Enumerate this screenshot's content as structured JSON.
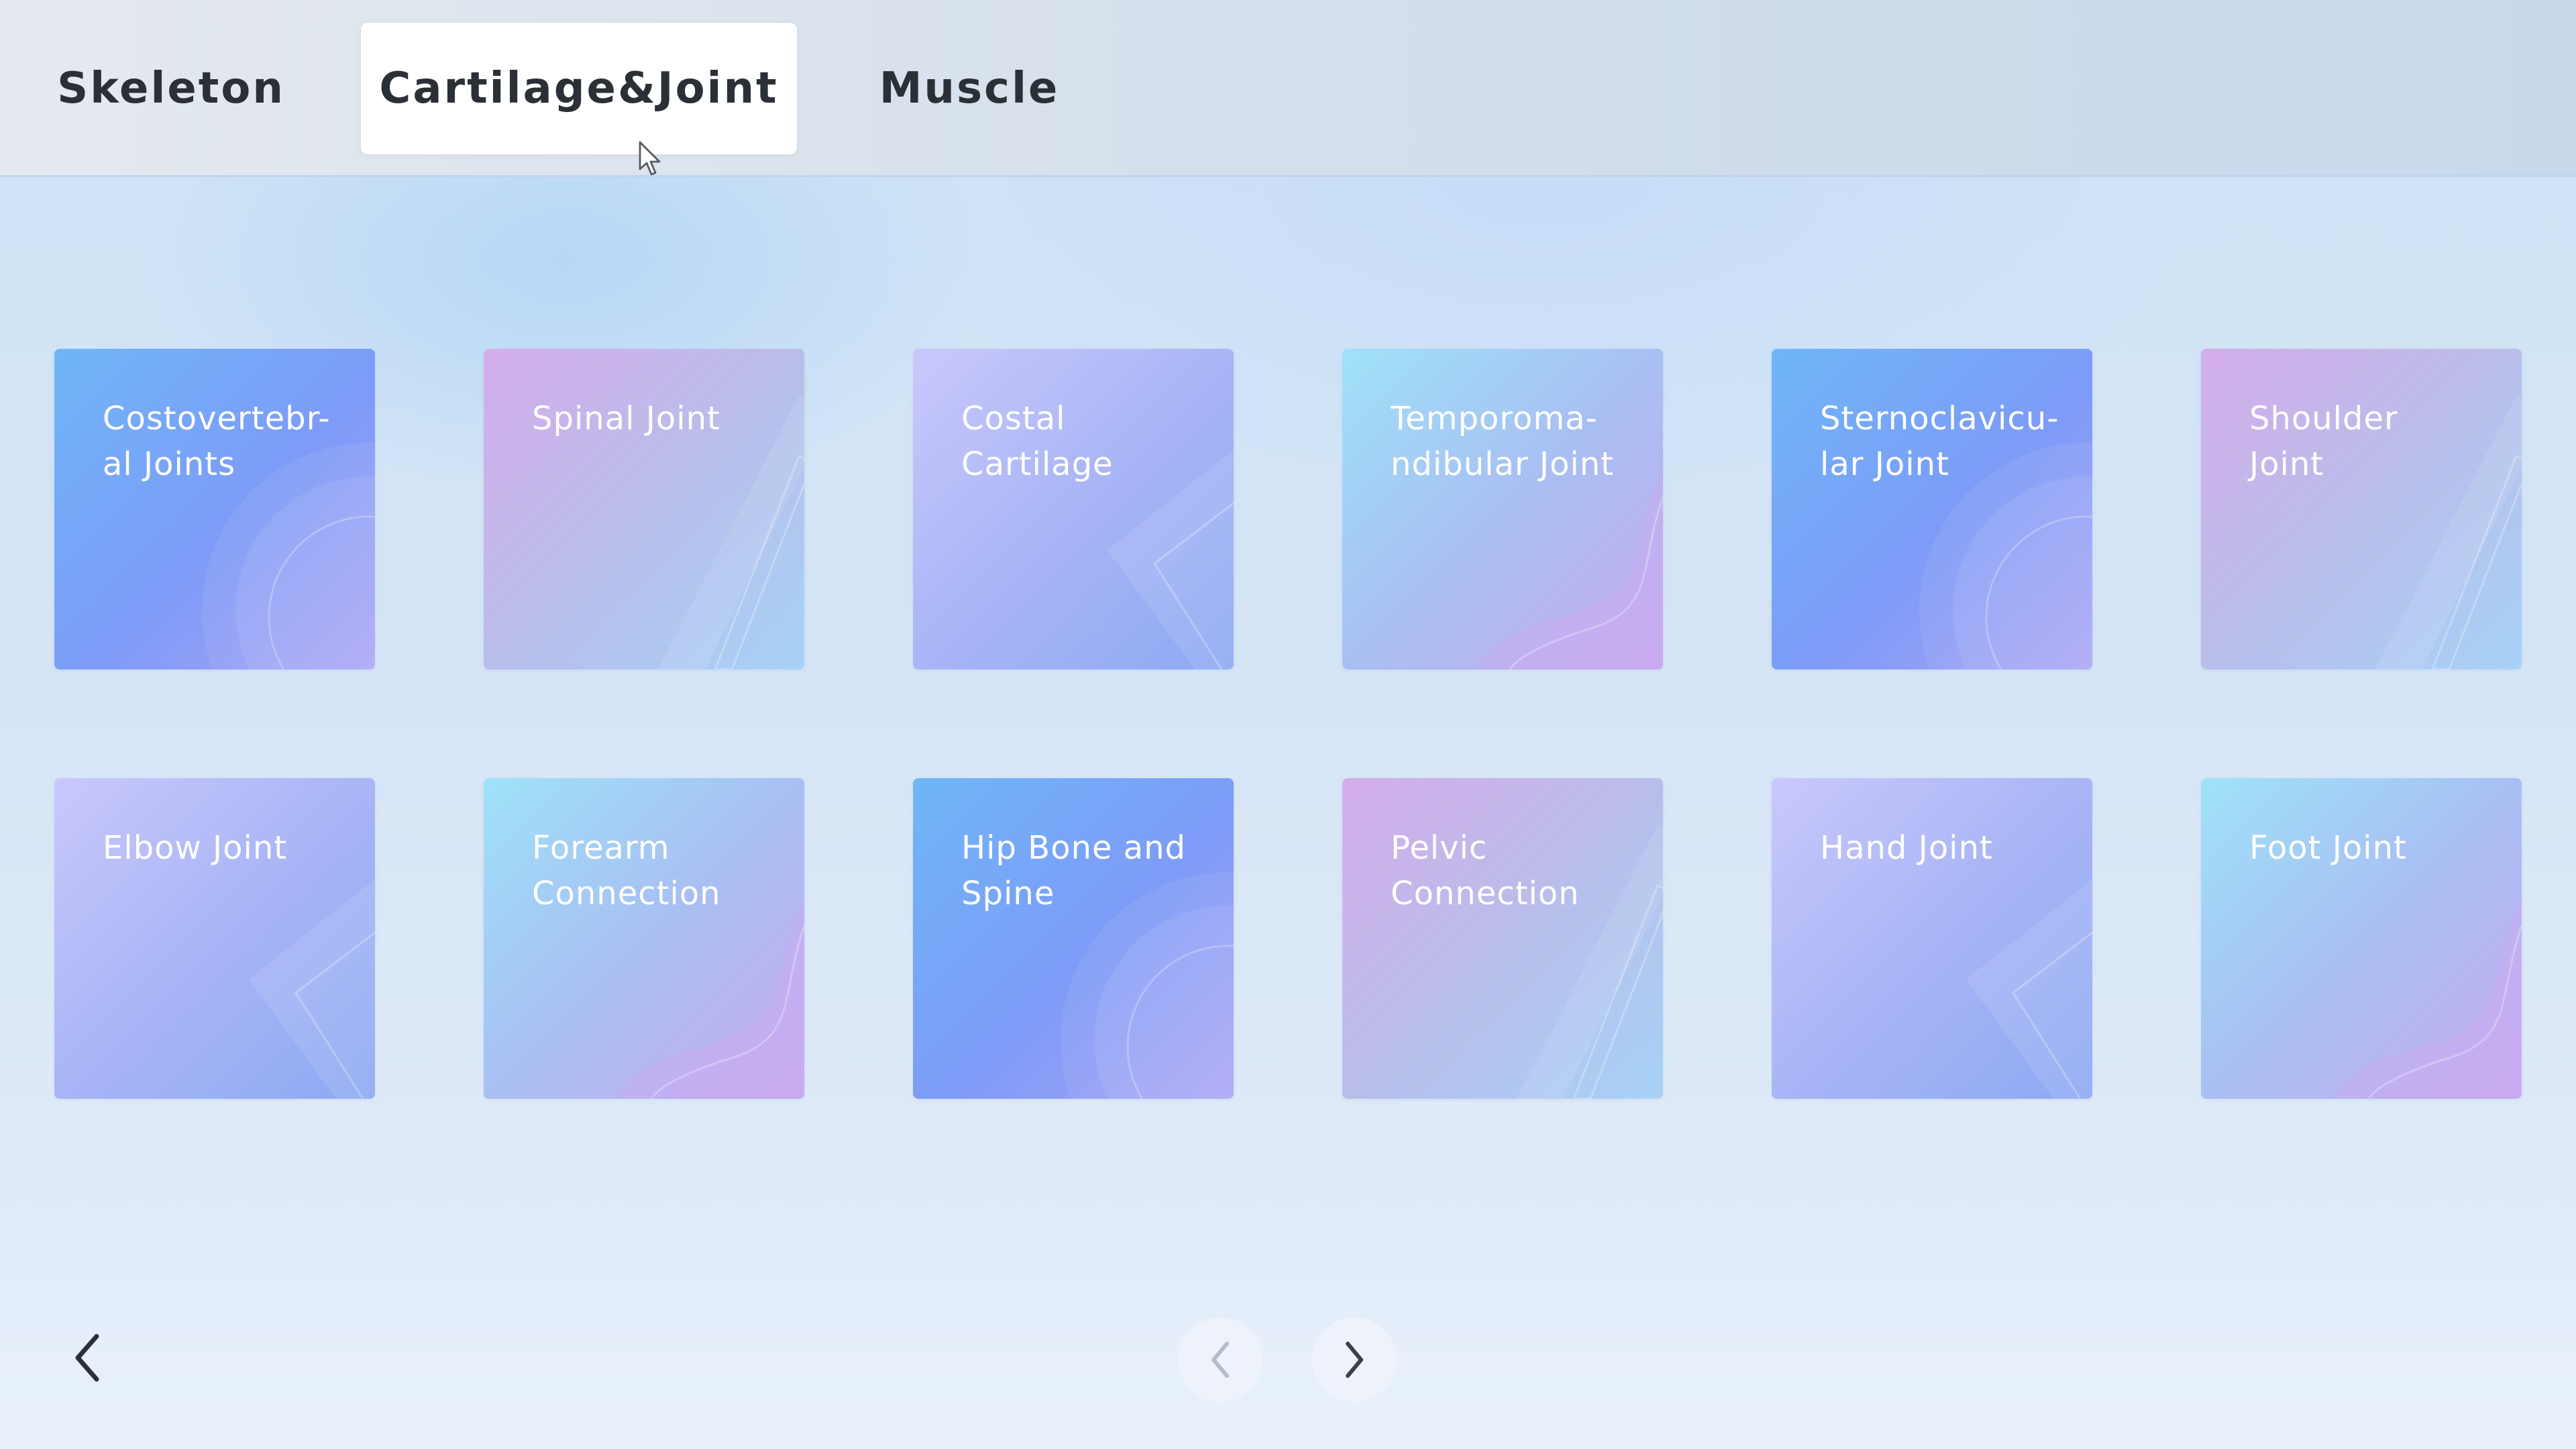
{
  "tabs": [
    {
      "label": "Skeleton",
      "active": false
    },
    {
      "label": "Cartilage&Joint",
      "active": true
    },
    {
      "label": "Muscle",
      "active": false
    }
  ],
  "tiles": [
    {
      "label": "Costovertebr-\nal Joints",
      "style": "blue",
      "decoration": "arc-icon"
    },
    {
      "label": "Spinal Joint",
      "style": "pink",
      "decoration": "slash-icon"
    },
    {
      "label": "Costal\nCartilage",
      "style": "lavender",
      "decoration": "chevron-icon"
    },
    {
      "label": "Temporoma-\nndibular Joint",
      "style": "cyan",
      "decoration": "wave-icon"
    },
    {
      "label": "Sternoclavicu-\nlar Joint",
      "style": "blue",
      "decoration": "arc-icon"
    },
    {
      "label": "Shoulder\nJoint",
      "style": "pink",
      "decoration": "slash-icon"
    },
    {
      "label": "Elbow Joint",
      "style": "lavender",
      "decoration": "chevron-icon"
    },
    {
      "label": "Forearm\nConnection",
      "style": "cyan",
      "decoration": "wave-icon"
    },
    {
      "label": "Hip Bone and\nSpine",
      "style": "blue",
      "decoration": "arc-icon"
    },
    {
      "label": "Pelvic\nConnection",
      "style": "pink",
      "decoration": "slash-icon"
    },
    {
      "label": "Hand Joint",
      "style": "lavender",
      "decoration": "chevron-icon"
    },
    {
      "label": "Foot Joint",
      "style": "cyan",
      "decoration": "wave-icon"
    }
  ],
  "navigation": {
    "back_icon": "chevron-left-icon",
    "prev_icon": "chevron-left-icon",
    "next_icon": "chevron-right-icon",
    "prev_enabled": false,
    "next_enabled": true
  },
  "colors": {
    "tab_text": "#2b2f36",
    "tile_text": "#ffffff",
    "arrow_enabled": "#3a3f48",
    "arrow_disabled": "#b3bccb"
  }
}
